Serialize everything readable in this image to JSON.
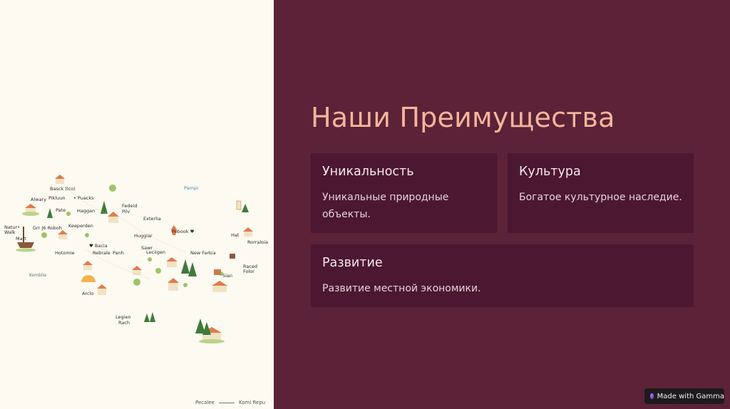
{
  "map": {
    "labels": {
      "basck": "Basck (lco)",
      "alwary": "Alwary",
      "pikluun": "Pikluun",
      "puacks": "• Puacks",
      "fedeid": "Fedeid",
      "pilv": "Pilv",
      "pate": "Pate",
      "haggan": "Haggan",
      "exterlia": "Exterlia",
      "natur_walk": "Natur•",
      "walk": "Walk",
      "grr": "Grr J6 Roboh",
      "keeperden": "Keeperden",
      "mart": "Mart",
      "huggiar": "Huggiar",
      "pebook": "Pebook ♥",
      "hat": "Hat",
      "bacia": "♥ Bacia",
      "rebrale": "Rebrale",
      "panh": "Panh",
      "saw": "Sawr",
      "leciigen": "Leciigen",
      "rorraloia": "Rorraloia",
      "hotomie": "Hotomie",
      "new_farkia": "New Farkia",
      "kombiia": "Kombiia",
      "sian": "Sian",
      "raced": "Raced",
      "folor": "Folor",
      "arclo": "Arclo",
      "legien": "Legien",
      "rach": "Rach",
      "pamp": "Pampi"
    },
    "footer_left": "Pecalee",
    "footer_right": "Komi Repu"
  },
  "slide": {
    "title": "Наши Преимущества",
    "cards": [
      {
        "title": "Уникальность",
        "text": "Уникальные природные объекты."
      },
      {
        "title": "Культура",
        "text": "Богатое культурное наследие."
      },
      {
        "title": "Развитие",
        "text": "Развитие местной экономики."
      }
    ]
  },
  "badge": {
    "label": "Made with Gamma"
  },
  "colors": {
    "background": "#5b2238",
    "card": "#4c1730",
    "title": "#f6b59b",
    "map_bg": "#fdfaf1"
  }
}
